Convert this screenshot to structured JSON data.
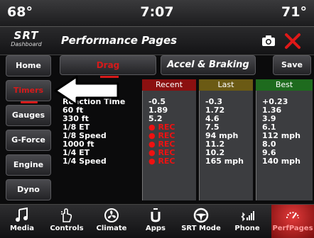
{
  "status": {
    "temp_left": "68°",
    "clock": "7:07",
    "temp_right": "71°"
  },
  "header": {
    "logo_big": "SRT",
    "logo_small": "Dashboard",
    "title": "Performance Pages"
  },
  "sidebar": {
    "items": [
      {
        "label": "Home"
      },
      {
        "label": "Timers"
      },
      {
        "label": "Gauges"
      },
      {
        "label": "G-Force"
      },
      {
        "label": "Engine"
      },
      {
        "label": "Dyno"
      }
    ]
  },
  "tabs": {
    "drag": "Drag",
    "accel": "Accel & Braking",
    "save": "Save"
  },
  "table": {
    "row_labels": [
      "Reaction Time",
      "60 ft",
      "330 ft",
      "1/8 ET",
      "1/8 Speed",
      "1000 ft",
      "1/4 ET",
      "1/4 Speed"
    ],
    "columns": [
      {
        "header": "Recent",
        "values": [
          "-0.5",
          "1.89",
          "5.2",
          "REC",
          "REC",
          "REC",
          "REC",
          "REC"
        ]
      },
      {
        "header": "Last",
        "values": [
          "-0.3",
          "1.72",
          "4.6",
          "7.5",
          "94 mph",
          "11.2",
          "10.2",
          "165 mph"
        ]
      },
      {
        "header": "Best",
        "values": [
          "+0.23",
          "1.36",
          "3.9",
          "6.1",
          "112 mph",
          "8.0",
          "9.6",
          "140 mph"
        ]
      }
    ]
  },
  "bottombar": {
    "items": [
      {
        "label": "Media"
      },
      {
        "label": "Controls"
      },
      {
        "label": "Climate"
      },
      {
        "label": "Apps"
      },
      {
        "label": "SRT Mode"
      },
      {
        "label": "Phone"
      },
      {
        "label": "PerfPages"
      }
    ]
  },
  "colors": {
    "accent_red": "#d61a1a",
    "recent_head": "#8b1010",
    "last_head": "#6b5a14",
    "best_head": "#1e6b1e"
  }
}
